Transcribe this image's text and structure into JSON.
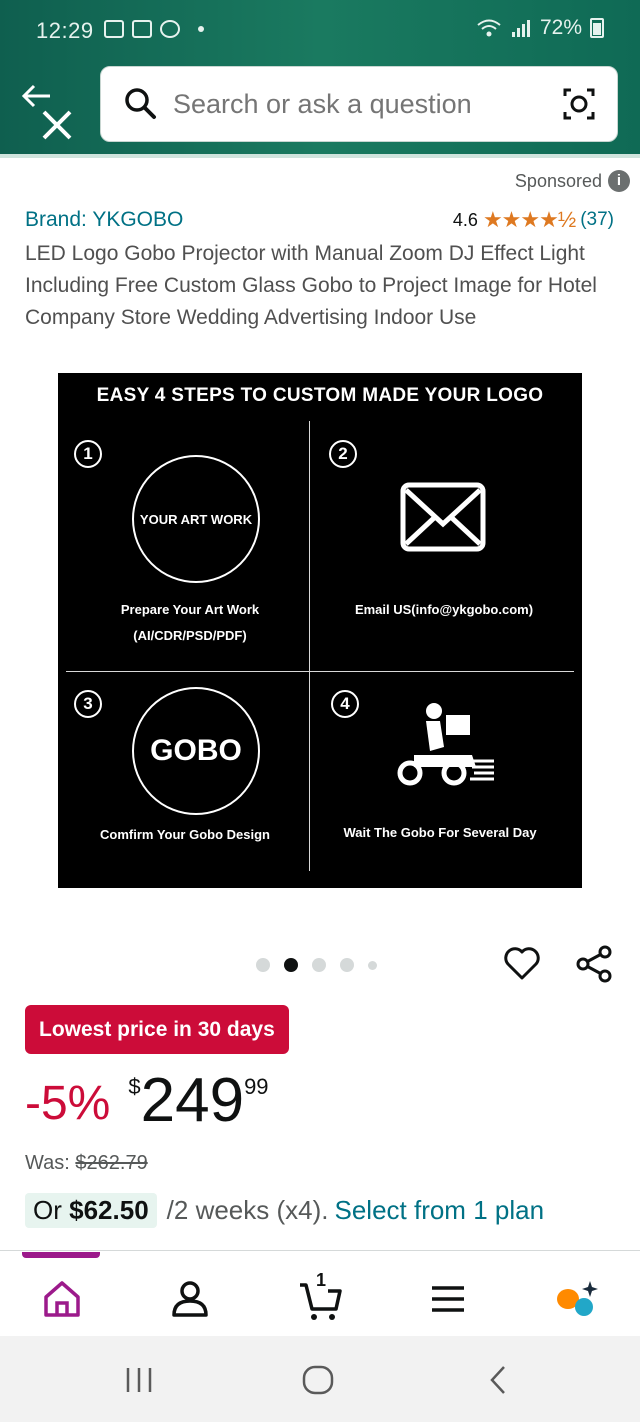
{
  "status_bar": {
    "time": "12:29",
    "battery": "72%"
  },
  "search": {
    "placeholder": "Search or ask a question"
  },
  "listing": {
    "sponsored_label": "Sponsored",
    "brand": "Brand: YKGOBO",
    "rating_value": "4.6",
    "stars": "★★★★½",
    "rating_count": "(37)",
    "title": "LED Logo Gobo Projector with Manual Zoom DJ Effect Light Including Free Custom Glass Gobo to Project Image for Hotel Company Store Wedding Advertising Indoor Use"
  },
  "product_image": {
    "heading": "EASY 4 STEPS TO CUSTOM MADE YOUR LOGO",
    "steps": [
      {
        "number": "1",
        "circle_text": "YOUR ART WORK",
        "caption_line1": "Prepare Your Art Work",
        "caption_line2": "(AI/CDR/PSD/PDF)"
      },
      {
        "number": "2",
        "caption_line1": "Email US(info@ykgobo.com)"
      },
      {
        "number": "3",
        "circle_text": "GOBO",
        "caption_line1": "Comfirm Your Gobo Design"
      },
      {
        "number": "4",
        "caption_line1": "Wait The Gobo For Several Day"
      }
    ]
  },
  "carousel": {
    "total_dots": 5,
    "active_index": 1
  },
  "pricing": {
    "deal_badge": "Lowest price in 30 days",
    "discount": "-5%",
    "currency": "$",
    "price_whole": "249",
    "price_fraction": "99",
    "was_label": "Was:",
    "was_price": "$262.79",
    "installment_prefix": "Or",
    "installment_amount": "$62.50",
    "installment_terms": "/2 weeks (x4).",
    "installment_link": "Select from 1 plan"
  },
  "bottom_nav": {
    "cart_count": "1"
  },
  "colors": {
    "header": "#1a7a60",
    "deal": "#cc0c39",
    "link": "#007185",
    "star": "#de7921",
    "nav_indicator": "#9c1a8b"
  }
}
